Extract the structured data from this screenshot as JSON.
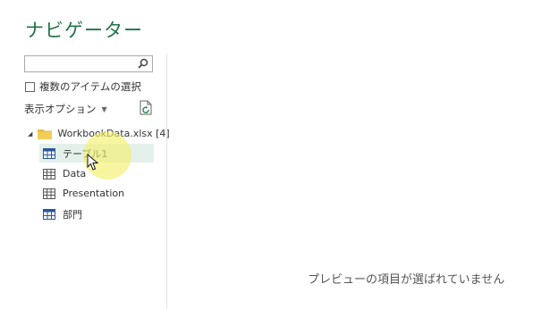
{
  "navigator": {
    "title": "ナビゲーター",
    "search": {
      "value": "",
      "placeholder": ""
    },
    "multi_select_label": "複数のアイテムの選択",
    "display_options_label": "表示オプション",
    "tree": {
      "root_label": "WorkbookData.xlsx [4]",
      "items": [
        {
          "label": "テーブル1",
          "icon": "table-icon",
          "selected": true
        },
        {
          "label": "Data",
          "icon": "sheet-icon",
          "selected": false
        },
        {
          "label": "Presentation",
          "icon": "sheet-icon",
          "selected": false
        },
        {
          "label": "部門",
          "icon": "table-icon",
          "selected": false
        }
      ]
    }
  },
  "preview": {
    "empty_message": "プレビューの項目が選ばれていません"
  },
  "colors": {
    "title": "#217346",
    "selected_row": "#e4f1ea",
    "folder": "#e8b93a",
    "table_icon": "#2b579a",
    "cursor_highlight": "#f5f06e"
  }
}
